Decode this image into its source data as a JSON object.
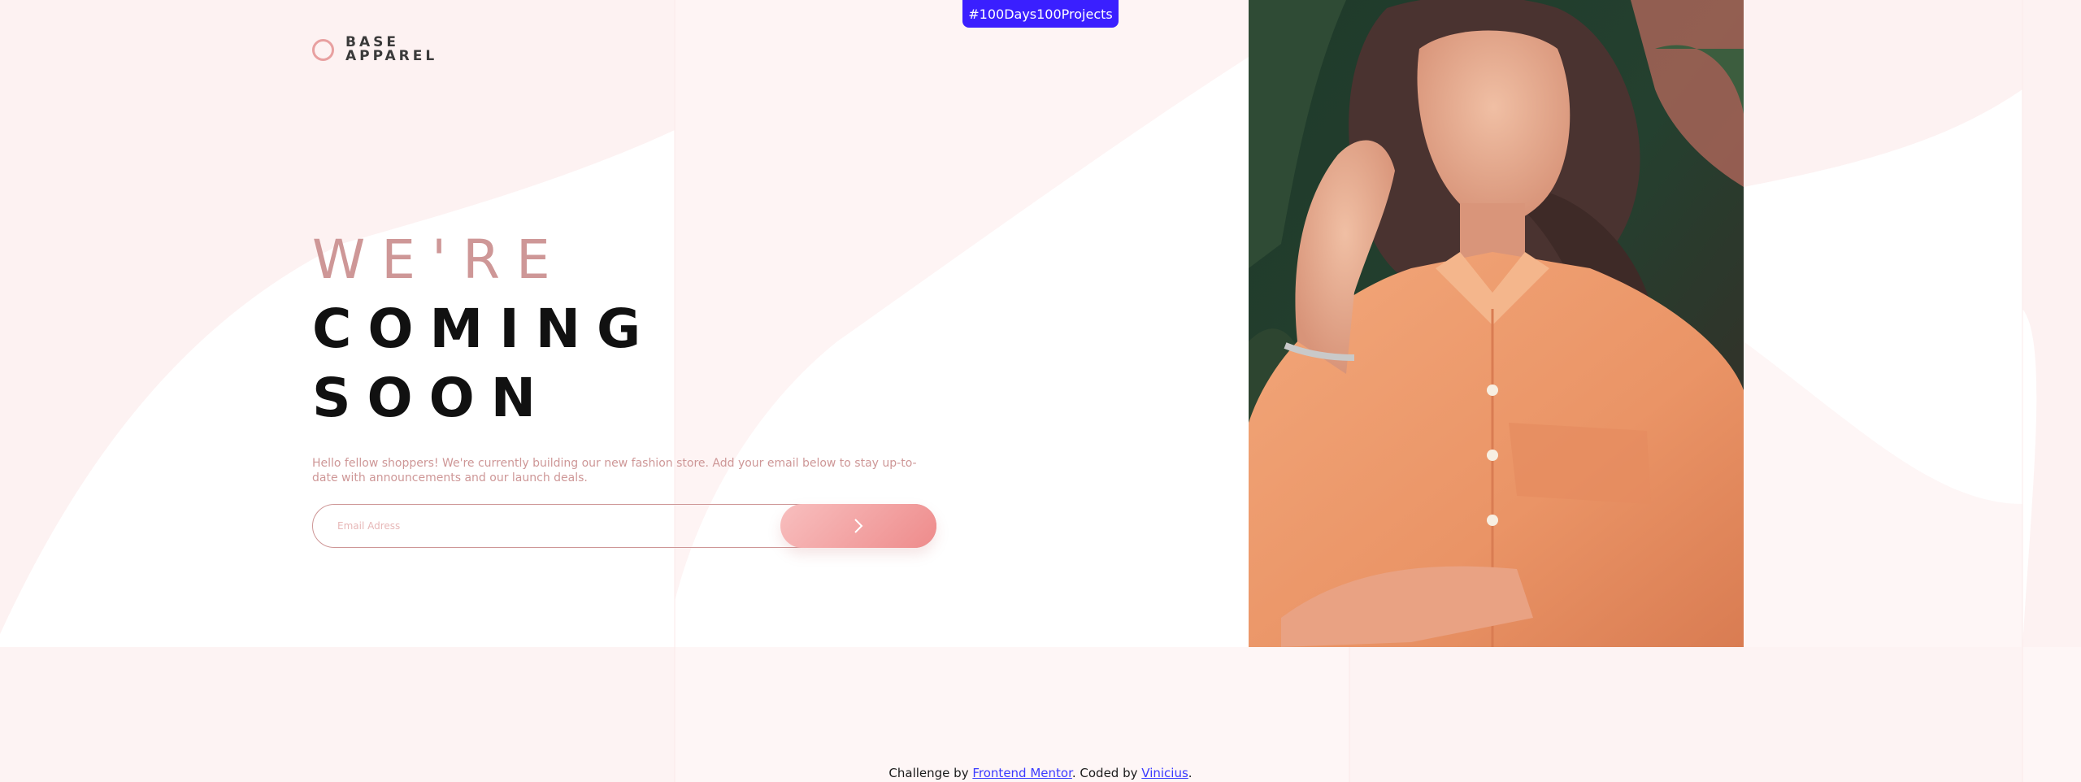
{
  "badge": "#100Days100Projects",
  "logo": {
    "line1": "BASE",
    "line2": "APPAREL"
  },
  "headline": {
    "line1": "WE'RE",
    "line2": "COMING",
    "line3": "SOON"
  },
  "description": "Hello fellow shoppers! We're currently building our new fashion store. Add your email below to stay up-to-date with announcements and our launch deals.",
  "form": {
    "placeholder": "Email Adress",
    "submit_icon": "chevron-right-icon"
  },
  "hero": {
    "icon": "model-photo"
  },
  "footer": {
    "prefix": "Challenge by",
    "link1": "Frontend Mentor",
    "middle": ". Coded by",
    "link2": "Vinicius",
    "suffix": "."
  },
  "colors": {
    "accent": "#ce9797",
    "badge": "#3a1fff",
    "button_start": "#f8bfbf",
    "button_end": "#ee8b8b",
    "pattern": "#fdf1f1"
  }
}
